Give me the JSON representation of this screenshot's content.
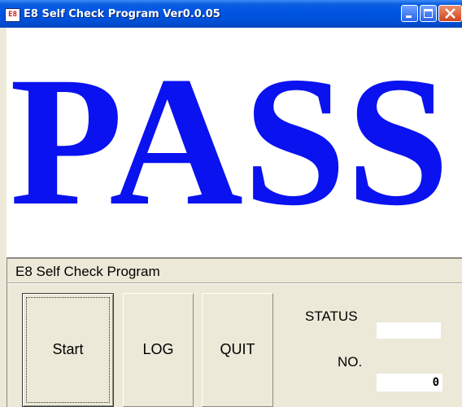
{
  "window": {
    "icon_text": "E8",
    "title": "E8 Self Check Program Ver0.0.05"
  },
  "result": {
    "text": "PASS",
    "color": "#0a12f0"
  },
  "panel": {
    "title": "E8 Self Check Program",
    "buttons": {
      "start": "Start",
      "log": "LOG",
      "quit": "QUIT"
    },
    "status_label": "STATUS",
    "status_value": "",
    "no_label": "NO.",
    "no_value": "0"
  },
  "icons": {
    "minimize": "minimize-icon",
    "maximize": "maximize-icon",
    "close": "close-icon"
  }
}
